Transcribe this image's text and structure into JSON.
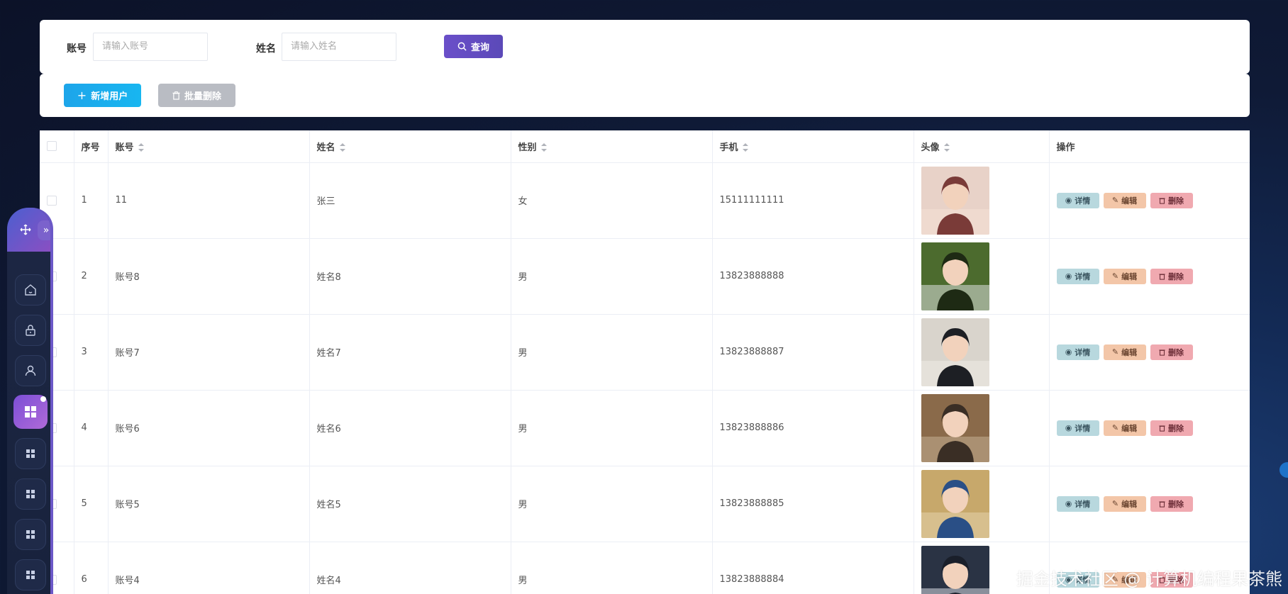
{
  "search": {
    "account_label": "账号",
    "account_placeholder": "请输入账号",
    "name_label": "姓名",
    "name_placeholder": "请输入姓名",
    "query_label": "查询"
  },
  "actions": {
    "add_label": "新增用户",
    "batch_delete_label": "批量删除"
  },
  "table": {
    "headers": {
      "index": "序号",
      "account": "账号",
      "name": "姓名",
      "gender": "性别",
      "phone": "手机",
      "avatar": "头像",
      "ops": "操作"
    },
    "op_labels": {
      "detail": "详情",
      "edit": "编辑",
      "delete": "删除"
    },
    "rows": [
      {
        "index": "1",
        "account": "11",
        "name": "张三",
        "gender": "女",
        "phone": "15111111111"
      },
      {
        "index": "2",
        "account": "账号8",
        "name": "姓名8",
        "gender": "男",
        "phone": "13823888888"
      },
      {
        "index": "3",
        "account": "账号7",
        "name": "姓名7",
        "gender": "男",
        "phone": "13823888887"
      },
      {
        "index": "4",
        "account": "账号6",
        "name": "姓名6",
        "gender": "男",
        "phone": "13823888886"
      },
      {
        "index": "5",
        "account": "账号5",
        "name": "姓名5",
        "gender": "男",
        "phone": "13823888885"
      },
      {
        "index": "6",
        "account": "账号4",
        "name": "姓名4",
        "gender": "男",
        "phone": "13823888884"
      }
    ]
  },
  "sidebar": {
    "items": [
      "move-icon",
      "home-icon",
      "lock-icon",
      "user-icon",
      "grid-icon",
      "grid-icon",
      "grid-icon",
      "grid-icon",
      "grid-icon"
    ]
  },
  "watermark": "掘金技术社区 @ 计算机编程果茶熊",
  "colors": {
    "query": "#5b49b8",
    "add": "#1da5ea",
    "batch_delete": "#b9bcc3",
    "detail": "#b8d8de",
    "edit": "#f3c6a8",
    "delete": "#f0a9b0"
  }
}
